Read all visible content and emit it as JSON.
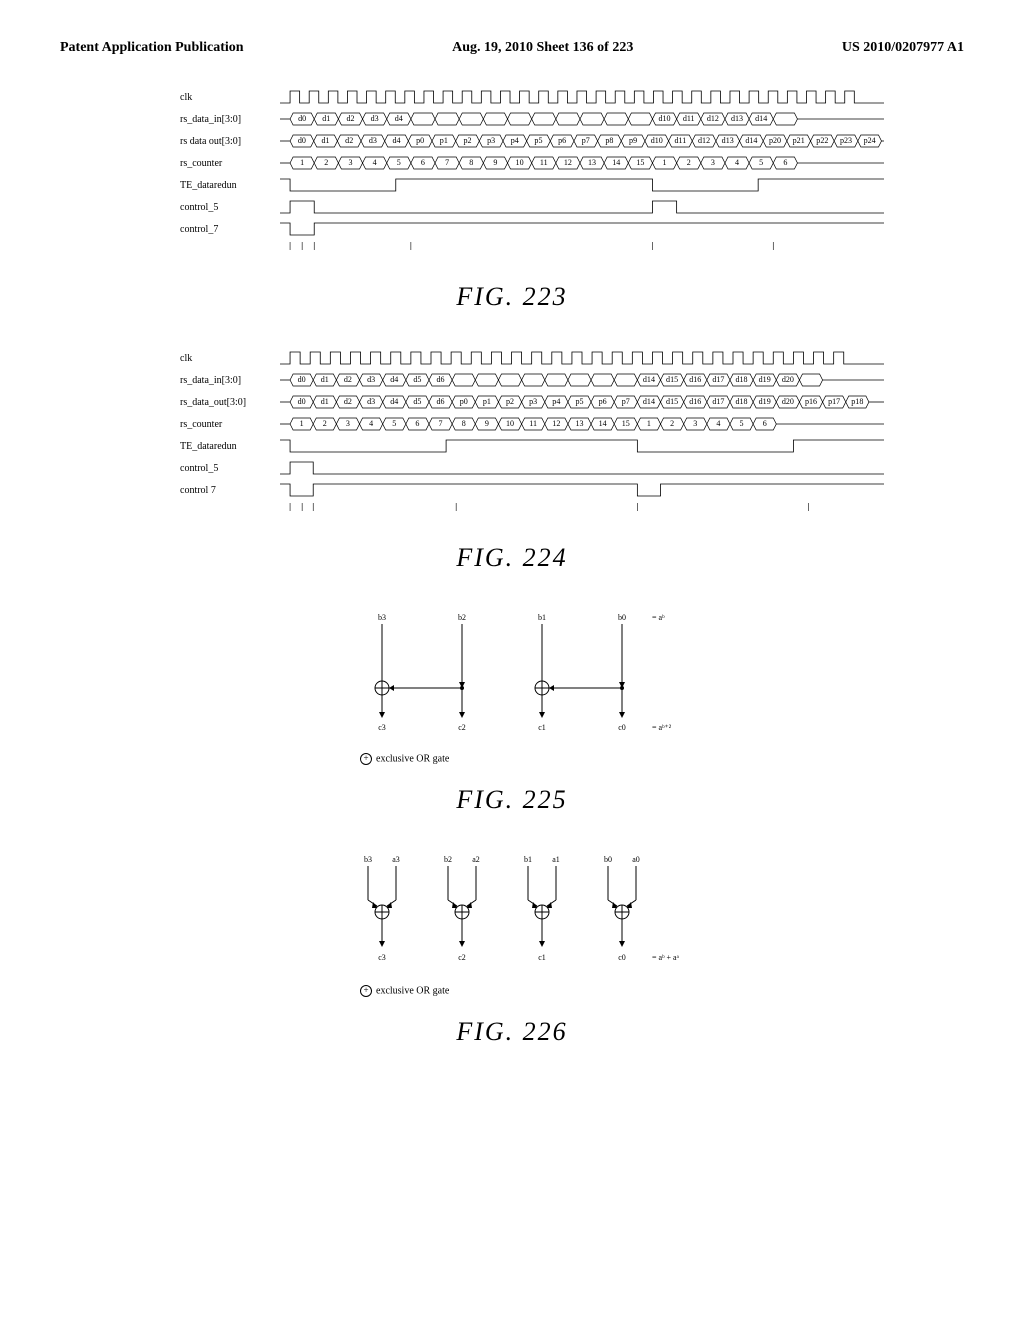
{
  "header": {
    "left": "Patent Application Publication",
    "center": "Aug. 19, 2010  Sheet 136 of 223",
    "right": "US 2010/0207977 A1"
  },
  "fig223": {
    "caption": "FIG. 223",
    "signals": [
      "clk",
      "rs_data_in[3:0]",
      "rs data out[3:0]",
      "rs_counter",
      "TE_dataredun",
      "control_5",
      "control_7"
    ],
    "data_in": [
      "d0",
      "d1",
      "d2",
      "d3",
      "d4",
      "",
      "",
      "",
      "",
      "",
      "",
      "",
      "",
      "",
      "",
      "d10",
      "d11",
      "d12",
      "d13",
      "d14",
      ""
    ],
    "data_out": [
      "d0",
      "d1",
      "d2",
      "d3",
      "d4",
      "p0",
      "p1",
      "p2",
      "p3",
      "p4",
      "p5",
      "p6",
      "p7",
      "p8",
      "p9",
      "d10",
      "d11",
      "d12",
      "d13",
      "d14",
      "p20",
      "p21",
      "p22",
      "p23",
      "p24"
    ],
    "counter": [
      "1",
      "2",
      "3",
      "4",
      "5",
      "6",
      "7",
      "8",
      "9",
      "10",
      "11",
      "12",
      "13",
      "14",
      "15",
      "1",
      "2",
      "3",
      "4",
      "5",
      "6"
    ]
  },
  "fig224": {
    "caption": "FIG. 224",
    "signals": [
      "clk",
      "rs_data_in[3:0]",
      "rs_data_out[3:0]",
      "rs_counter",
      "TE_dataredun",
      "control_5",
      "control 7"
    ],
    "data_in": [
      "d0",
      "d1",
      "d2",
      "d3",
      "d4",
      "d5",
      "d6",
      "",
      "",
      "",
      "",
      "",
      "",
      "",
      "",
      "d14",
      "d15",
      "d16",
      "d17",
      "d18",
      "d19",
      "d20",
      ""
    ],
    "data_out": [
      "d0",
      "d1",
      "d2",
      "d3",
      "d4",
      "d5",
      "d6",
      "p0",
      "p1",
      "p2",
      "p3",
      "p4",
      "p5",
      "p6",
      "p7",
      "d14",
      "d15",
      "d16",
      "d17",
      "d18",
      "d19",
      "d20",
      "p16",
      "p17",
      "p18"
    ],
    "counter": [
      "1",
      "2",
      "3",
      "4",
      "5",
      "6",
      "7",
      "8",
      "9",
      "10",
      "11",
      "12",
      "13",
      "14",
      "15",
      "1",
      "2",
      "3",
      "4",
      "5",
      "6"
    ]
  },
  "fig225": {
    "caption": "FIG. 225",
    "inputs_top": [
      "b3",
      "b2",
      "b1",
      "b0"
    ],
    "eq_top": "= aᵇ",
    "outputs_bot": [
      "c3",
      "c2",
      "c1",
      "c0"
    ],
    "eq_bot": "= aᵇ⁺²",
    "note": "exclusive OR gate"
  },
  "fig226": {
    "caption": "FIG. 226",
    "inputs_pairs": [
      [
        "b3",
        "a3"
      ],
      [
        "b2",
        "a2"
      ],
      [
        "b1",
        "a1"
      ],
      [
        "b0",
        "a0"
      ]
    ],
    "outputs_bot": [
      "c3",
      "c2",
      "c1",
      "c0"
    ],
    "eq_bot": "= aᵇ + aᵃ",
    "note": "exclusive OR gate"
  }
}
